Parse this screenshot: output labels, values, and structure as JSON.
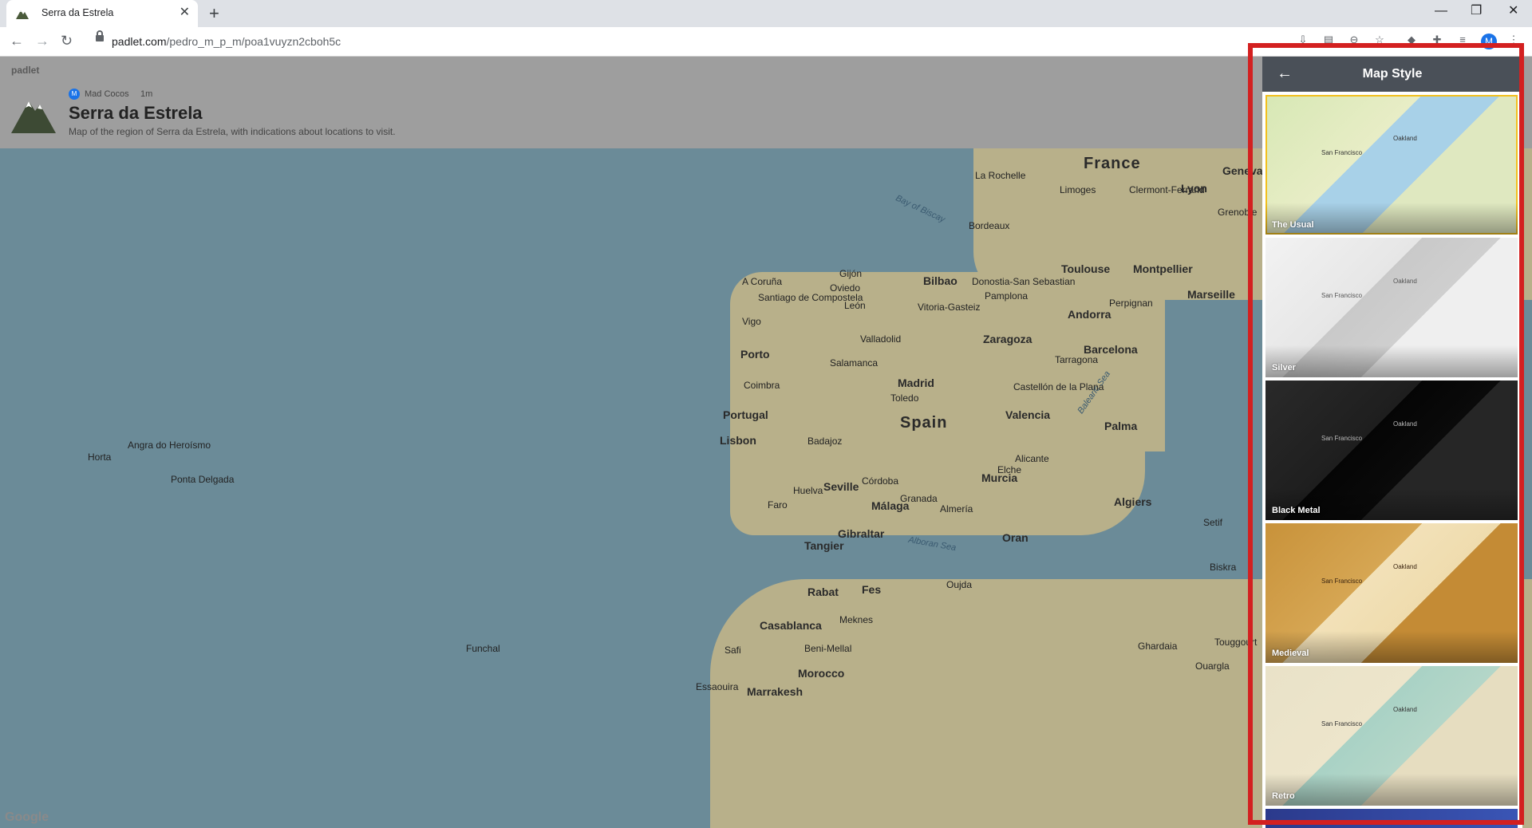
{
  "browser": {
    "tab_title": "Serra da Estrela",
    "url_host": "padlet.com",
    "url_path": "/pedro_m_p_m/poa1vuyzn2cboh5c",
    "profile_initial": "M"
  },
  "header": {
    "brand": "padlet",
    "author_initial": "M",
    "author": "Mad Cocos",
    "time": "1m",
    "title": "Serra da Estrela",
    "description": "Map of the region of Serra da Estrela, with indications about locations to visit."
  },
  "map": {
    "countries": [
      "France",
      "Spain",
      "Portugal",
      "Morocco"
    ],
    "cities": [
      "La Rochelle",
      "Limoges",
      "Clermont-Ferrand",
      "Lyon",
      "Geneva",
      "Grenoble",
      "Bordeaux",
      "Toulouse",
      "Montpellier",
      "Marseille",
      "Perpignan",
      "Andorra",
      "Bilbao",
      "Donostia-San Sebastian",
      "Vitoria-Gasteiz",
      "Pamplona",
      "A Coruña",
      "Gijón",
      "Oviedo",
      "Santiago de Compostela",
      "León",
      "Vigo",
      "Valladolid",
      "Zaragoza",
      "Barcelona",
      "Tarragona",
      "Porto",
      "Salamanca",
      "Madrid",
      "Toledo",
      "Coimbra",
      "Castellón de la Plana",
      "Valencia",
      "Palma",
      "Lisbon",
      "Badajoz",
      "Córdoba",
      "Alicante",
      "Elche",
      "Murcia",
      "Huelva",
      "Seville",
      "Granada",
      "Almería",
      "Faro",
      "Málaga",
      "Gibraltar",
      "Tangier",
      "Oran",
      "Algiers",
      "Rabat",
      "Fes",
      "Meknes",
      "Oujda",
      "Casablanca",
      "Beni-Mellal",
      "Safi",
      "Essaouira",
      "Marrakesh",
      "Funchal",
      "Ponta Delgada",
      "Angra do Heroísmo",
      "Horta",
      "Ghardaia",
      "Touggourt",
      "Ouargla",
      "Biskra",
      "Setif"
    ],
    "seas": [
      "Bay of Biscay",
      "Balearic Sea",
      "Alboran Sea"
    ],
    "attribution": "Google"
  },
  "panel": {
    "title": "Map Style",
    "styles": [
      {
        "name": "The Usual",
        "selected": true
      },
      {
        "name": "Silver",
        "selected": false
      },
      {
        "name": "Black Metal",
        "selected": false
      },
      {
        "name": "Medieval",
        "selected": false
      },
      {
        "name": "Retro",
        "selected": false
      }
    ]
  }
}
